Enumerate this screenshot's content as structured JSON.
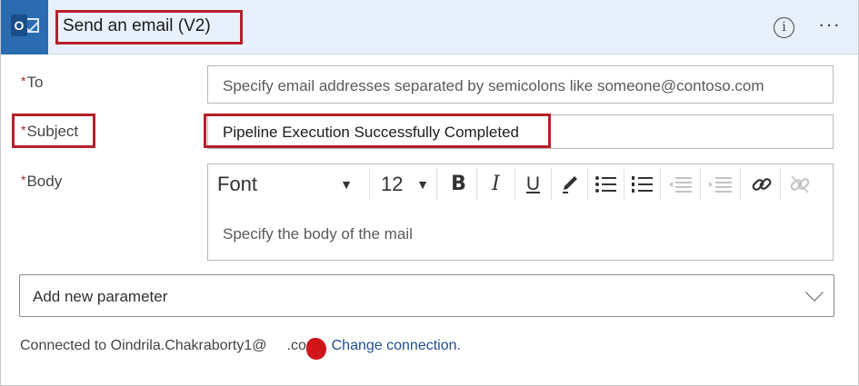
{
  "header": {
    "title": "Send an email (V2)",
    "app_icon": "outlook-icon",
    "info_icon": "info-icon",
    "more_icon": "more-icon",
    "info_glyph": "i",
    "more_glyph": "···"
  },
  "fields": {
    "to": {
      "label": "To",
      "placeholder": "Specify email addresses separated by semicolons like someone@contoso.com"
    },
    "subject": {
      "label": "Subject",
      "value": "Pipeline Execution Successfully Completed"
    },
    "body": {
      "label": "Body",
      "placeholder": "Specify the body of the mail",
      "toolbar": {
        "font": "Font",
        "size": "12",
        "bold": "B",
        "italic": "I",
        "underline": "U"
      }
    }
  },
  "add_parameter": {
    "label": "Add new parameter"
  },
  "footer": {
    "connected_text": "Connected to Oindrila.Chakraborty1@",
    "connected_suffix": ".com.",
    "change_link": "Change connection."
  },
  "colors": {
    "header_bg": "#e8f1fb",
    "highlight": "#b5202a",
    "required": "#a4262c",
    "link": "#1f4f8f",
    "app_icon": "#2b6cb0"
  }
}
